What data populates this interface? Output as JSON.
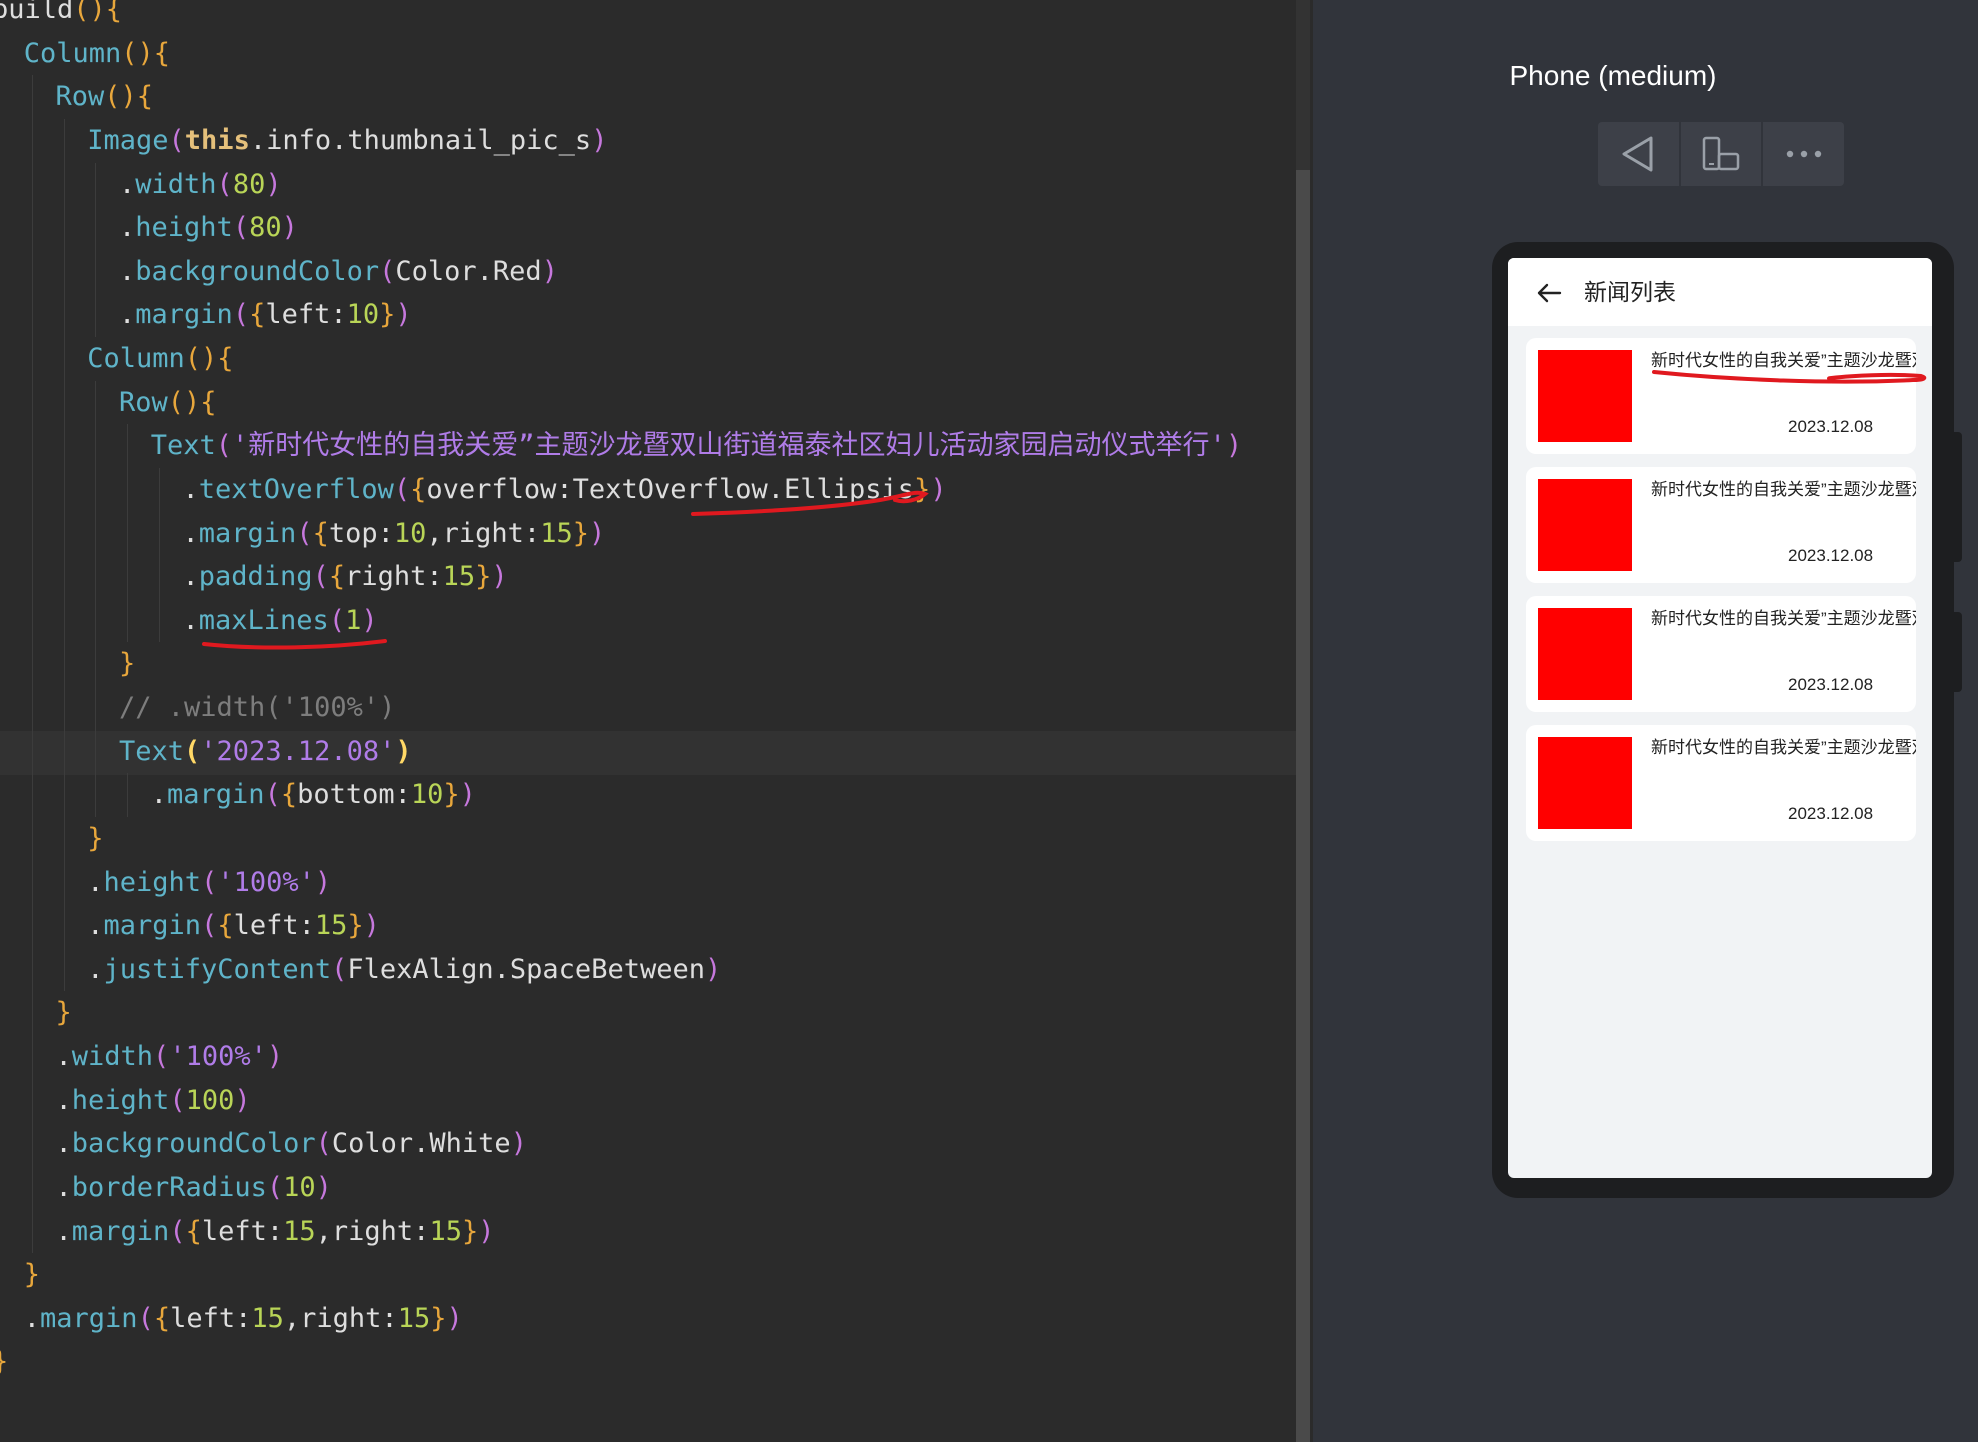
{
  "editor": {
    "lines": [
      {
        "indent": 0,
        "parts": [
          [
            "id",
            "build"
          ],
          [
            "p1",
            "(){"
          ]
        ]
      },
      {
        "indent": 1,
        "parts": [
          [
            "fn",
            "Column"
          ],
          [
            "p1",
            "(){"
          ]
        ]
      },
      {
        "indent": 2,
        "parts": [
          [
            "fn",
            "Row"
          ],
          [
            "p1",
            "(){"
          ]
        ]
      },
      {
        "indent": 3,
        "parts": [
          [
            "fn",
            "Image"
          ],
          [
            "p2",
            "("
          ],
          [
            "kw",
            "this"
          ],
          [
            "id",
            ".info.thumbnail_pic_s"
          ],
          [
            "p2",
            ")"
          ]
        ]
      },
      {
        "indent": 4,
        "parts": [
          [
            "id",
            "."
          ],
          [
            "fn",
            "width"
          ],
          [
            "p2",
            "("
          ],
          [
            "num",
            "80"
          ],
          [
            "p2",
            ")"
          ]
        ]
      },
      {
        "indent": 4,
        "parts": [
          [
            "id",
            "."
          ],
          [
            "fn",
            "height"
          ],
          [
            "p2",
            "("
          ],
          [
            "num",
            "80"
          ],
          [
            "p2",
            ")"
          ]
        ]
      },
      {
        "indent": 4,
        "parts": [
          [
            "id",
            "."
          ],
          [
            "fn",
            "backgroundColor"
          ],
          [
            "p2",
            "("
          ],
          [
            "id",
            "Color.Red"
          ],
          [
            "p2",
            ")"
          ]
        ]
      },
      {
        "indent": 4,
        "parts": [
          [
            "id",
            "."
          ],
          [
            "fn",
            "margin"
          ],
          [
            "p2",
            "("
          ],
          [
            "p1",
            "{"
          ],
          [
            "id",
            "left:"
          ],
          [
            "num",
            "10"
          ],
          [
            "p1",
            "}"
          ],
          [
            "p2",
            ")"
          ]
        ]
      },
      {
        "indent": 3,
        "parts": [
          [
            "fn",
            "Column"
          ],
          [
            "p1",
            "(){"
          ]
        ]
      },
      {
        "indent": 4,
        "parts": [
          [
            "fn",
            "Row"
          ],
          [
            "p1",
            "(){"
          ]
        ]
      },
      {
        "indent": 5,
        "parts": [
          [
            "fn",
            "Text"
          ],
          [
            "p2",
            "("
          ],
          [
            "str",
            "'新时代女性的自我关爱”主题沙龙暨双山街道福泰社区妇儿活动家园启动仪式举行'"
          ],
          [
            "p2",
            ")"
          ]
        ]
      },
      {
        "indent": 6,
        "parts": [
          [
            "id",
            "."
          ],
          [
            "fn",
            "textOverflow"
          ],
          [
            "p2",
            "("
          ],
          [
            "p1",
            "{"
          ],
          [
            "id",
            "overflow:TextOverflow.Ellipsis"
          ],
          [
            "p1",
            "}"
          ],
          [
            "p2",
            ")"
          ]
        ]
      },
      {
        "indent": 6,
        "parts": [
          [
            "id",
            "."
          ],
          [
            "fn",
            "margin"
          ],
          [
            "p2",
            "("
          ],
          [
            "p1",
            "{"
          ],
          [
            "id",
            "top:"
          ],
          [
            "num",
            "10"
          ],
          [
            "id",
            ",right:"
          ],
          [
            "num",
            "15"
          ],
          [
            "p1",
            "}"
          ],
          [
            "p2",
            ")"
          ]
        ]
      },
      {
        "indent": 6,
        "parts": [
          [
            "id",
            "."
          ],
          [
            "fn",
            "padding"
          ],
          [
            "p2",
            "("
          ],
          [
            "p1",
            "{"
          ],
          [
            "id",
            "right:"
          ],
          [
            "num",
            "15"
          ],
          [
            "p1",
            "}"
          ],
          [
            "p2",
            ")"
          ]
        ]
      },
      {
        "indent": 6,
        "parts": [
          [
            "id",
            "."
          ],
          [
            "fn",
            "maxLines"
          ],
          [
            "p2",
            "("
          ],
          [
            "num",
            "1"
          ],
          [
            "p2",
            ")"
          ]
        ]
      },
      {
        "indent": 4,
        "parts": [
          [
            "p1",
            "}"
          ]
        ]
      },
      {
        "indent": 4,
        "parts": [
          [
            "cm",
            "// .width('100%')"
          ]
        ]
      },
      {
        "indent": 4,
        "parts": [
          [
            "fn",
            "Text"
          ],
          [
            "yel",
            "("
          ],
          [
            "str",
            "'2023.12.08'"
          ],
          [
            "yel",
            ")"
          ]
        ]
      },
      {
        "indent": 5,
        "parts": [
          [
            "id",
            "."
          ],
          [
            "fn",
            "margin"
          ],
          [
            "p2",
            "("
          ],
          [
            "p1",
            "{"
          ],
          [
            "id",
            "bottom:"
          ],
          [
            "num",
            "10"
          ],
          [
            "p1",
            "}"
          ],
          [
            "p2",
            ")"
          ]
        ]
      },
      {
        "indent": 3,
        "parts": [
          [
            "p1",
            "}"
          ]
        ]
      },
      {
        "indent": 3,
        "parts": [
          [
            "id",
            "."
          ],
          [
            "fn",
            "height"
          ],
          [
            "p2",
            "("
          ],
          [
            "str",
            "'100%'"
          ],
          [
            "p2",
            ")"
          ]
        ]
      },
      {
        "indent": 3,
        "parts": [
          [
            "id",
            "."
          ],
          [
            "fn",
            "margin"
          ],
          [
            "p2",
            "("
          ],
          [
            "p1",
            "{"
          ],
          [
            "id",
            "left:"
          ],
          [
            "num",
            "15"
          ],
          [
            "p1",
            "}"
          ],
          [
            "p2",
            ")"
          ]
        ]
      },
      {
        "indent": 3,
        "parts": [
          [
            "id",
            "."
          ],
          [
            "fn",
            "justifyContent"
          ],
          [
            "p2",
            "("
          ],
          [
            "id",
            "FlexAlign.SpaceBetween"
          ],
          [
            "p2",
            ")"
          ]
        ]
      },
      {
        "indent": 2,
        "parts": [
          [
            "p1",
            "}"
          ]
        ]
      },
      {
        "indent": 2,
        "parts": [
          [
            "id",
            "."
          ],
          [
            "fn",
            "width"
          ],
          [
            "p2",
            "("
          ],
          [
            "str",
            "'100%'"
          ],
          [
            "p2",
            ")"
          ]
        ]
      },
      {
        "indent": 2,
        "parts": [
          [
            "id",
            "."
          ],
          [
            "fn",
            "height"
          ],
          [
            "p2",
            "("
          ],
          [
            "num",
            "100"
          ],
          [
            "p2",
            ")"
          ]
        ]
      },
      {
        "indent": 2,
        "parts": [
          [
            "id",
            "."
          ],
          [
            "fn",
            "backgroundColor"
          ],
          [
            "p2",
            "("
          ],
          [
            "id",
            "Color.White"
          ],
          [
            "p2",
            ")"
          ]
        ]
      },
      {
        "indent": 2,
        "parts": [
          [
            "id",
            "."
          ],
          [
            "fn",
            "borderRadius"
          ],
          [
            "p2",
            "("
          ],
          [
            "num",
            "10"
          ],
          [
            "p2",
            ")"
          ]
        ]
      },
      {
        "indent": 2,
        "parts": [
          [
            "id",
            "."
          ],
          [
            "fn",
            "margin"
          ],
          [
            "p2",
            "("
          ],
          [
            "p1",
            "{"
          ],
          [
            "id",
            "left:"
          ],
          [
            "num",
            "15"
          ],
          [
            "id",
            ",right:"
          ],
          [
            "num",
            "15"
          ],
          [
            "p1",
            "}"
          ],
          [
            "p2",
            ")"
          ]
        ]
      },
      {
        "indent": 1,
        "parts": [
          [
            "p1",
            "}"
          ]
        ]
      },
      {
        "indent": 1,
        "parts": [
          [
            "id",
            "."
          ],
          [
            "fn",
            "margin"
          ],
          [
            "p2",
            "("
          ],
          [
            "p1",
            "{"
          ],
          [
            "id",
            "left:"
          ],
          [
            "num",
            "15"
          ],
          [
            "id",
            ",right:"
          ],
          [
            "num",
            "15"
          ],
          [
            "p1",
            "}"
          ],
          [
            "p2",
            ")"
          ]
        ]
      },
      {
        "indent": 0,
        "parts": [
          [
            "p1",
            "}"
          ]
        ]
      }
    ]
  },
  "previewer": {
    "device_label": "Phone (medium)",
    "toolbar": {
      "icons": [
        "back-triangle-icon",
        "rotate-device-icon",
        "more-icon"
      ]
    },
    "app": {
      "title": "新闻列表",
      "cards": [
        {
          "title": "新时代女性的自我关爱”主题沙龙暨双山街道福泰社区妇儿活动家园启动仪式举行",
          "date": "2023.12.08"
        },
        {
          "title": "新时代女性的自我关爱”主题沙龙暨双山街道福泰社区妇儿活动家园启动仪式举行",
          "date": "2023.12.08"
        },
        {
          "title": "新时代女性的自我关爱”主题沙龙暨双山街道福泰社区妇儿活动家园启动仪式举行",
          "date": "2023.12.08"
        },
        {
          "title": "新时代女性的自我关爱”主题沙龙暨双山街道福泰社区妇儿活动家园启动仪式举行",
          "date": "2023.12.08"
        }
      ],
      "thumb_color": "#ff0000"
    }
  },
  "colors": {
    "editor_bg": "#2b2b2b",
    "previewer_bg": "#31343b",
    "annotation": "#e0191f"
  }
}
